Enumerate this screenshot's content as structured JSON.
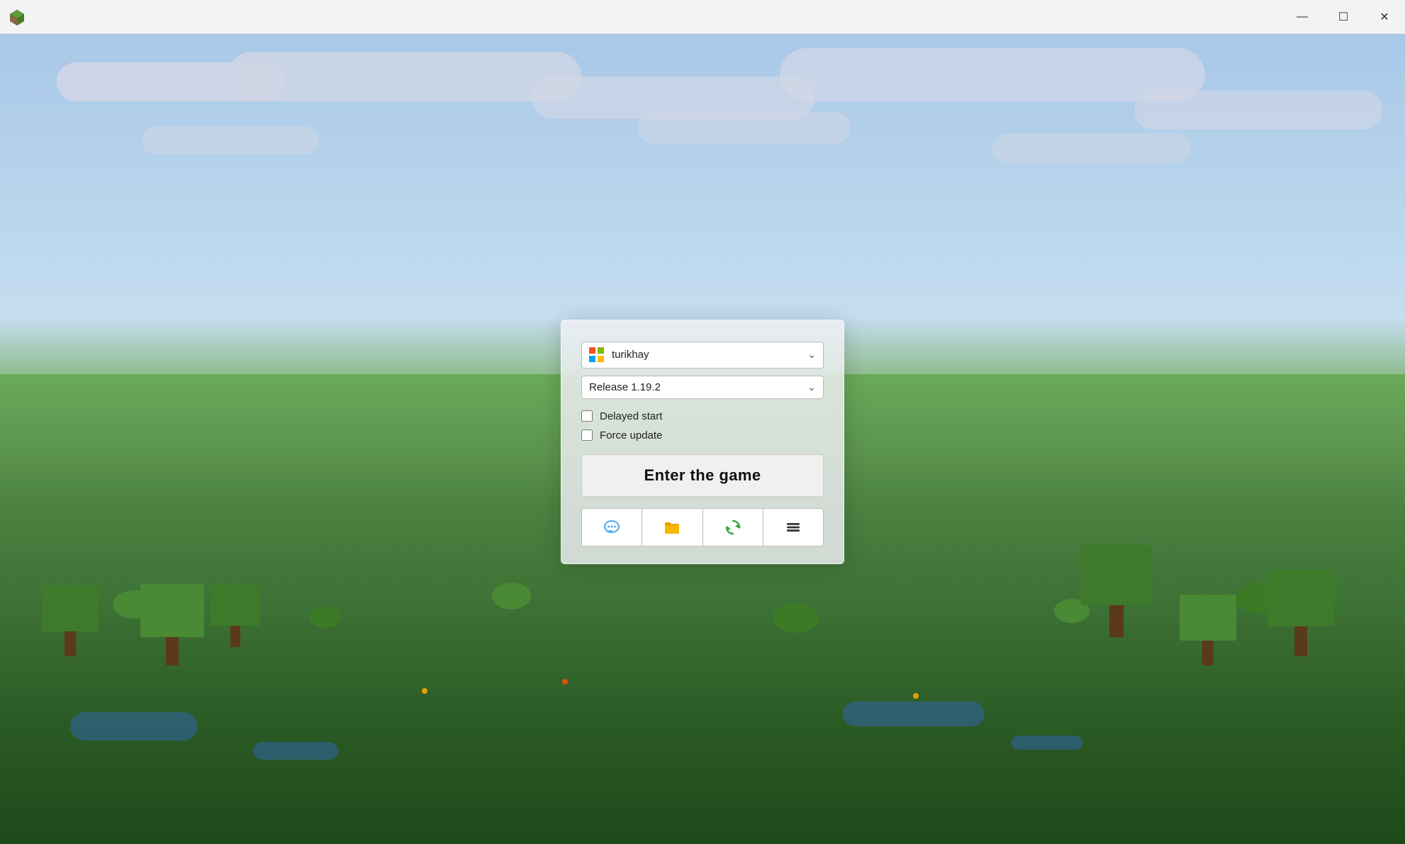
{
  "titlebar": {
    "app_icon_alt": "Minecraft Launcher Icon",
    "controls": {
      "minimize": "—",
      "maximize": "☐",
      "close": "✕"
    }
  },
  "dialog": {
    "account": {
      "name": "turikhay",
      "placeholder": "turikhay"
    },
    "version": {
      "value": "Release 1.19.2",
      "placeholder": "Release 1.19.2"
    },
    "options": {
      "delayed_start": {
        "label": "Delayed start",
        "checked": false
      },
      "force_update": {
        "label": "Force update",
        "checked": false
      }
    },
    "enter_button": "Enter the game",
    "icons": {
      "chat": "chat-icon",
      "folder": "folder-icon",
      "refresh": "refresh-icon",
      "menu": "menu-icon"
    }
  },
  "background": {
    "type": "minecraft-landscape"
  }
}
